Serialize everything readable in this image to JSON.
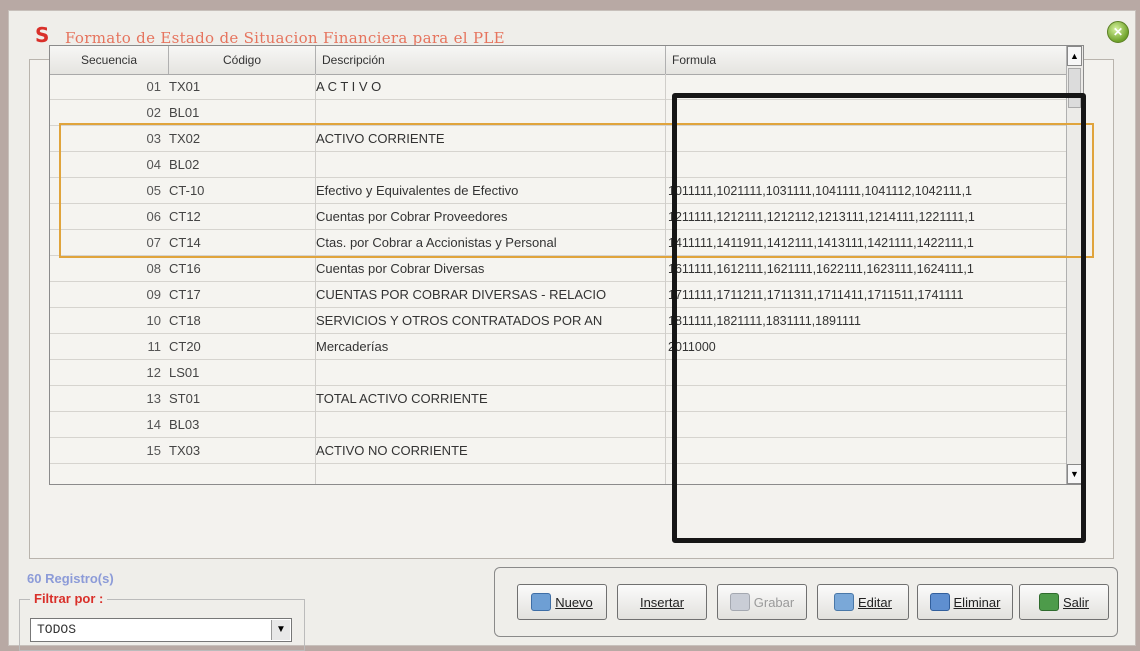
{
  "window": {
    "logo": "S",
    "title": "Formato de Estado de Situacion Financiera para el PLE"
  },
  "grid": {
    "columns": [
      "Secuencia",
      "Código",
      "Descripción",
      "Formula"
    ],
    "rows": [
      {
        "seq": "01",
        "code": "TX01",
        "desc": "A C T I V O",
        "formula": ""
      },
      {
        "seq": "02",
        "code": "BL01",
        "desc": "",
        "formula": ""
      },
      {
        "seq": "03",
        "code": "TX02",
        "desc": "ACTIVO CORRIENTE",
        "formula": ""
      },
      {
        "seq": "04",
        "code": "BL02",
        "desc": "",
        "formula": ""
      },
      {
        "seq": "05",
        "code": "CT-10",
        "desc": "Efectivo y Equivalentes de Efectivo",
        "formula": "1011111,1021111,1031111,1041111,1041112,1042111,1"
      },
      {
        "seq": "06",
        "code": "CT12",
        "desc": "Cuentas por Cobrar Proveedores",
        "formula": "1211111,1212111,1212112,1213111,1214111,1221111,1"
      },
      {
        "seq": "07",
        "code": "CT14",
        "desc": "Ctas. por Cobrar a Accionistas y Personal",
        "formula": "1411111,1411911,1412111,1413111,1421111,1422111,1"
      },
      {
        "seq": "08",
        "code": "CT16",
        "desc": "Cuentas por Cobrar Diversas",
        "formula": "1611111,1612111,1621111,1622111,1623111,1624111,1"
      },
      {
        "seq": "09",
        "code": "CT17",
        "desc": "CUENTAS POR COBRAR DIVERSAS - RELACIO",
        "formula": "1711111,1711211,1711311,1711411,1711511,1741111"
      },
      {
        "seq": "10",
        "code": "CT18",
        "desc": "SERVICIOS Y OTROS CONTRATADOS POR AN",
        "formula": "1811111,1821111,1831111,1891111"
      },
      {
        "seq": "11",
        "code": "CT20",
        "desc": "Mercaderías",
        "formula": "2011000"
      },
      {
        "seq": "12",
        "code": "LS01",
        "desc": "",
        "formula": ""
      },
      {
        "seq": "13",
        "code": "ST01",
        "desc": "TOTAL ACTIVO CORRIENTE",
        "formula": ""
      },
      {
        "seq": "14",
        "code": "BL03",
        "desc": "",
        "formula": ""
      },
      {
        "seq": "15",
        "code": "TX03",
        "desc": "ACTIVO NO CORRIENTE",
        "formula": ""
      }
    ]
  },
  "footer": {
    "records": "60 Registro(s)",
    "filter_label": "Filtrar por :",
    "filter_value": "TODOS"
  },
  "buttons": {
    "nuevo": "Nuevo",
    "insertar": "Insertar",
    "grabar": "Grabar",
    "editar": "Editar",
    "eliminar": "Eliminar",
    "salir": "Salir"
  },
  "colors": {
    "highlight_rows": "#e0a43c",
    "highlight_formula": "#161616",
    "logo": "#d9302a"
  }
}
